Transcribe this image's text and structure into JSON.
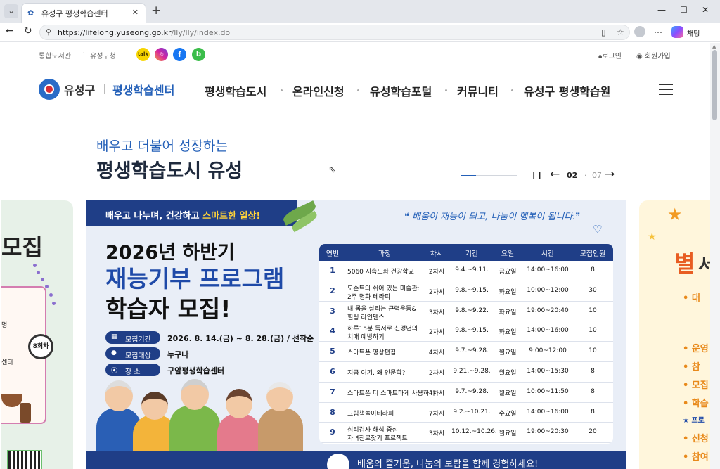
{
  "browser": {
    "tab_title": "유성구 평생학습센터",
    "url_host": "https://lifelong.yuseong.go.kr",
    "url_path": "/lly/lly/index.do",
    "chat_label": "채팅"
  },
  "util": {
    "links": [
      "통합도서관",
      "유성구청"
    ],
    "sns": [
      "kakao-icon",
      "instagram-icon",
      "facebook-icon",
      "blog-icon"
    ],
    "login": "로그인",
    "join": "회원가입"
  },
  "logo": {
    "name": "유성구",
    "center": "평생학습센터"
  },
  "nav": {
    "items": [
      "평생학습도시",
      "온라인신청",
      "유성학습포털",
      "커뮤니티",
      "유성구 평생학습원"
    ]
  },
  "hero": {
    "subtitle": "배우고 더불어 성장하는",
    "title": "평생학습도시 유성",
    "current": "02",
    "total": "07",
    "progress": 0.28
  },
  "left_slide": {
    "heading": "모집",
    "line1": "명",
    "line2": "센터",
    "timer": "8회차"
  },
  "slide": {
    "banner_pre": "배우고 나누며, 건강하고 ",
    "banner_hl": "스마트한 일상!",
    "quote": "❝ 배움이 재능이 되고, 나눔이 행복이 됩니다.❞",
    "year": "2026년 하반기",
    "main": "재능기부 프로그램",
    "recruit": "학습자 모집!",
    "info": [
      {
        "label": "모집기간",
        "value": "2026. 8. 14.(금) ~ 8. 28.(금) / 선착순"
      },
      {
        "label": "모집대상",
        "value": "누구나"
      },
      {
        "label": "장   소",
        "value": "구암평생학습센터"
      }
    ],
    "bottom": "배움의 즐거움, 나눔의 보람을 함께 경험하세요!"
  },
  "table": {
    "headers": [
      "연번",
      "과정",
      "차시",
      "기간",
      "요일",
      "시간",
      "모집인원"
    ],
    "rows": [
      [
        "1",
        "5060 지속노화 건강학교",
        "",
        "2차시",
        "9.4.~9.11.",
        "금요일",
        "14:00~16:00",
        "8"
      ],
      [
        "2",
        "도슨트의 쉬어 있는 미술관:",
        "2주 명화 테라피",
        "2차시",
        "9.8.~9.15.",
        "화요일",
        "10:00~12:00",
        "30"
      ],
      [
        "3",
        "내 몸을 살리는 근력운동&",
        "힐링 라인댄스",
        "3차시",
        "9.8.~9.22.",
        "화요일",
        "19:00~20:40",
        "10"
      ],
      [
        "4",
        "하루15분 독서로 신경년의",
        "치매 예방하기",
        "2차시",
        "9.8.~9.15.",
        "화요일",
        "14:00~16:00",
        "10"
      ],
      [
        "5",
        "스마트폰 영상편집",
        "",
        "4차시",
        "9.7.~9.28.",
        "월요일",
        "9:00~12:00",
        "10"
      ],
      [
        "6",
        "지금 여기, 왜 인문학?",
        "",
        "2차시",
        "9.21.~9.28.",
        "월요일",
        "14:00~15:30",
        "8"
      ],
      [
        "7",
        "스마트폰 더 스마트하게 사용하기",
        "",
        "4차시",
        "9.7.~9.28.",
        "월요일",
        "10:00~11:50",
        "8"
      ],
      [
        "8",
        "그림책놀이테라피",
        "",
        "7차시",
        "9.2.~10.21.",
        "수요일",
        "14:00~16:00",
        "8"
      ],
      [
        "9",
        "심리검사 해석 중심",
        "자녀진로찾기 프로젝트",
        "3차시",
        "10.12.~10.26.",
        "월요일",
        "19:00~20:30",
        "20"
      ]
    ]
  },
  "right_slide": {
    "big": "별",
    "big2": "서",
    "bullets": [
      "• 대",
      "• 운영",
      "• 참 ",
      "• 모집",
      "• 학습",
      "★ 프로",
      "• 신청",
      "• 참여"
    ]
  },
  "colors": {
    "brand_blue": "#2460b8",
    "navy": "#1f3e87",
    "highlight": "#ffd33a"
  }
}
